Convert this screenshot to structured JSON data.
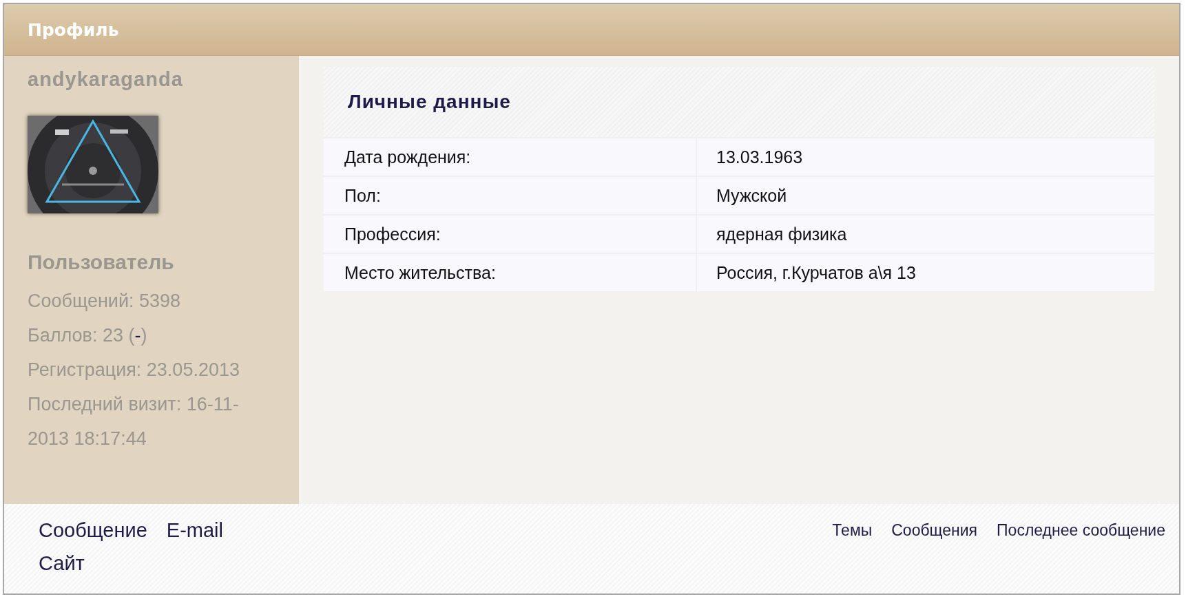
{
  "header": {
    "title": "Профиль"
  },
  "sidebar": {
    "username": "andykaraganda",
    "group": "Пользователь",
    "stats": [
      {
        "text": "Сообщений: 5398"
      },
      {
        "text": "Баллов: 23 (",
        "link": "-",
        "suffix": ")"
      },
      {
        "text": "Регистрация: 23.05.2013"
      },
      {
        "text": "Последний визит: 16-11-2013 18:17:44"
      }
    ]
  },
  "personal": {
    "title": "Личные данные",
    "rows": [
      {
        "label": "Дата рождения:",
        "value": "13.03.1963"
      },
      {
        "label": "Пол:",
        "value": "Мужской"
      },
      {
        "label": "Профессия:",
        "value": "ядерная физика"
      },
      {
        "label": "Место жительства:",
        "value": "Россия, г.Курчатов а\\я 13"
      }
    ]
  },
  "footer": {
    "contact_links": [
      "Сообщение",
      "E-mail",
      "Сайт"
    ],
    "activity_links": [
      "Темы",
      "Сообщения",
      "Последнее сообщение"
    ]
  }
}
